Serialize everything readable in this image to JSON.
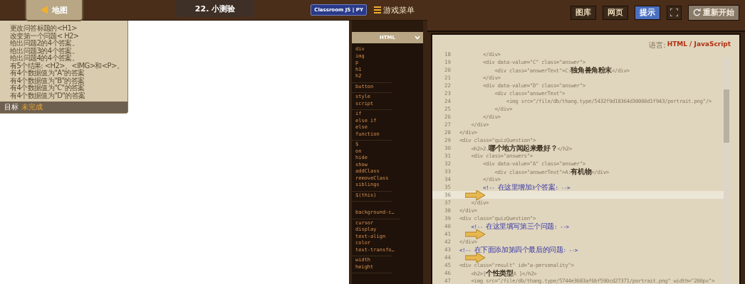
{
  "left_bar": {
    "map_button": "地图",
    "level_title": "22. 小测验",
    "classroom_badge": "Classroom JS | PY",
    "game_menu": "游戏菜单"
  },
  "goals": {
    "items": [
      "更改问答标题的<H1>",
      "改变第一个问题< H2>",
      "给出问题2的4个答案。",
      "给出问题3的4个答案。",
      "给出问题4的4个答案。",
      "有5个结果: <H2>、<IMG>和<P>。",
      "有4个数据值为\"A\"的答案",
      "有4个数据值为\"B\"的答案",
      "有4个数据值为\"C\"的答案",
      "有4个数据值为\"D\"的答案"
    ],
    "label": "目标",
    "status": "未完成"
  },
  "snippets": {
    "language": "HTML",
    "groups": [
      {
        "items": [
          "div",
          "img",
          "p",
          "h1",
          "h2"
        ]
      },
      {
        "items": [
          "button"
        ]
      },
      {
        "items": [
          "style",
          "script"
        ]
      },
      {
        "items": [
          "if",
          "else if",
          "else",
          "function"
        ]
      },
      {
        "items": [
          "$",
          "on",
          "hide",
          "show",
          "addClass",
          "removeClass",
          "siblings"
        ]
      },
      {
        "items": [
          "$(this)"
        ]
      },
      {
        "items": [
          "background-c…"
        ]
      },
      {
        "items": [
          "cursor",
          "display",
          "text-align",
          "color",
          "text-transfo…"
        ]
      },
      {
        "items": [
          "width",
          "height"
        ]
      }
    ]
  },
  "toolbar": [
    {
      "label": "图库",
      "selected": false,
      "kind": "text"
    },
    {
      "label": "网页",
      "selected": false,
      "kind": "text"
    },
    {
      "label": "提示",
      "selected": true,
      "kind": "text"
    },
    {
      "kind": "fullscreen",
      "selected": false
    },
    {
      "label": "重新开始",
      "selected": false,
      "kind": "restart"
    }
  ],
  "editor": {
    "language_label": "语言:",
    "language": "HTML / JavaScript",
    "lines": [
      {
        "number": "18",
        "text": "        </div>",
        "kind": "code",
        "selected": false
      },
      {
        "number": "19",
        "text": "        <div data-value=\"C\" class=\"answer\">",
        "kind": "code",
        "selected": false
      },
      {
        "number": "20",
        "text": "            <div class=\"answerText\">C:独角兽角粉末</div>",
        "kind": "code",
        "selected": false
      },
      {
        "number": "21",
        "text": "        </div>",
        "kind": "code",
        "selected": false
      },
      {
        "number": "22",
        "text": "        <div data-value=\"D\" class=\"answer\">",
        "kind": "code",
        "selected": false
      },
      {
        "number": "23",
        "text": "            <div class=\"answerText\">",
        "kind": "code",
        "selected": false
      },
      {
        "number": "24",
        "text": "                <img src=\"/file/db/thang.type/5432f9d18364d30000d1f943/portrait.png\"/>",
        "kind": "code",
        "selected": false
      },
      {
        "number": "25",
        "text": "            </div>",
        "kind": "code",
        "selected": false
      },
      {
        "number": "26",
        "text": "        </div>",
        "kind": "code",
        "selected": false
      },
      {
        "number": "27",
        "text": "    </div>",
        "kind": "code",
        "selected": false
      },
      {
        "number": "28",
        "text": "</div>",
        "kind": "code",
        "selected": false
      },
      {
        "number": "29",
        "text": "<div class=\"quizQuestion\">",
        "kind": "code",
        "selected": false
      },
      {
        "number": "30",
        "text": "    <h2>2.哪个地方闻起来最好？</h2>",
        "kind": "code",
        "selected": false
      },
      {
        "number": "31",
        "text": "    <div class=\"answers\">",
        "kind": "code",
        "selected": false
      },
      {
        "number": "32",
        "text": "        <div data-value=\"A\" class=\"answer\">",
        "kind": "code",
        "selected": false
      },
      {
        "number": "33",
        "text": "            <div class=\"answerText\">A:有机物</div>",
        "kind": "code",
        "selected": false
      },
      {
        "number": "34",
        "text": "        </div>",
        "kind": "code",
        "selected": false
      },
      {
        "number": "35",
        "text": "        <!-- 在这里增加3个答案: -->",
        "kind": "comment",
        "selected": false
      },
      {
        "number": "36",
        "selected": true,
        "arrow": true
      },
      {
        "number": "37",
        "text": "    </div>",
        "kind": "code",
        "selected": false
      },
      {
        "number": "38",
        "text": "</div>",
        "kind": "code",
        "selected": false
      },
      {
        "number": "39",
        "text": "<div class=\"quizQuestion\">",
        "kind": "code",
        "selected": false
      },
      {
        "number": "40",
        "text": "    <!-- 在这里填写第三个问题: -->",
        "kind": "comment",
        "selected": false
      },
      {
        "number": "41",
        "selected": false,
        "arrow": true
      },
      {
        "number": "42",
        "text": "</div>",
        "kind": "code",
        "selected": false
      },
      {
        "number": "43",
        "text": "<!-- 在下面添加第四个最后的问题: -->",
        "kind": "comment",
        "selected": false
      },
      {
        "number": "44",
        "selected": false,
        "arrow": true
      },
      {
        "number": "45",
        "text": "<div class=\"result\" id=\"a-personality\">",
        "kind": "code",
        "selected": false
      },
      {
        "number": "46",
        "text": "    <h2>[个性类型A ]</h2>",
        "kind": "code",
        "selected": false
      },
      {
        "number": "47",
        "text": "    <img src=\"/file/db/thang.type/5744e3683af6bf590cd27371/portrait.png\" width=\"200px\">",
        "kind": "code",
        "selected": false
      }
    ]
  }
}
